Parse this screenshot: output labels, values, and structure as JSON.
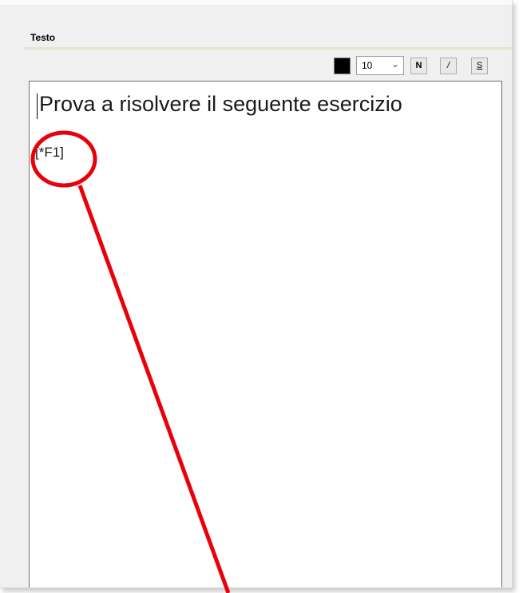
{
  "section": {
    "title": "Testo"
  },
  "toolbar": {
    "font_color": "#000000",
    "font_size": "10",
    "bold_label": "N",
    "italic_label": "/",
    "strike_label": "S"
  },
  "editor": {
    "lines": [
      "Prova a risolvere il seguente esercizio",
      "[*F1]"
    ]
  },
  "annotation": {
    "color": "#e8000b"
  }
}
